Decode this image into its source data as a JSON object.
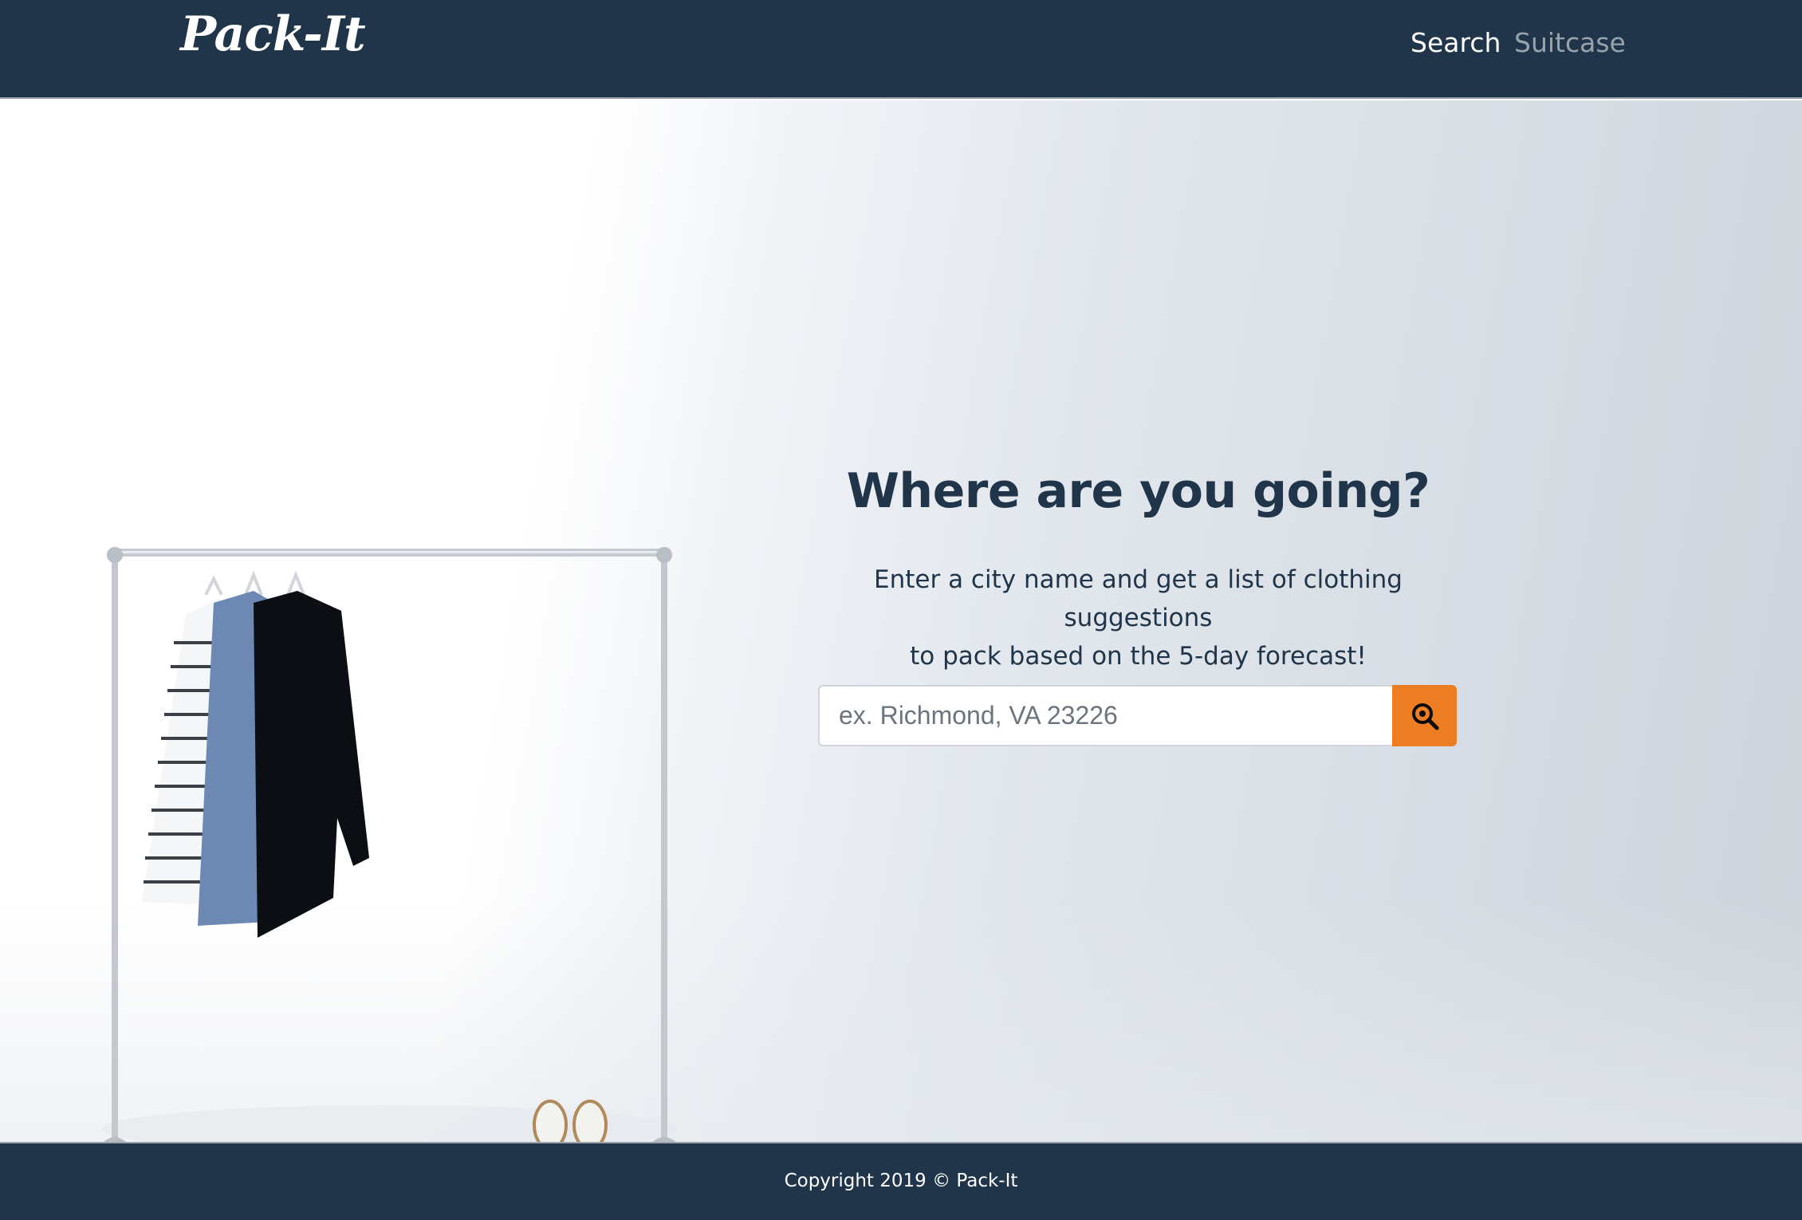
{
  "navbar": {
    "brand": "Pack-It",
    "links": [
      {
        "label": "Search",
        "active": true
      },
      {
        "label": "Suitcase",
        "active": false
      }
    ],
    "background_color": "#203549"
  },
  "hero": {
    "title": "Where are you going?",
    "subtitle_line1": "Enter a city name and get a list of clothing suggestions",
    "subtitle_line2": "to pack based on the 5-day forecast!",
    "search": {
      "placeholder": "ex. Richmond, VA 23226",
      "value": "",
      "button_icon": "search-zoom-icon",
      "button_color": "#ed7d22"
    },
    "background_image": "clothing-rack-photo"
  },
  "footer": {
    "copyright": "Copyright 2019 © Pack-It"
  }
}
